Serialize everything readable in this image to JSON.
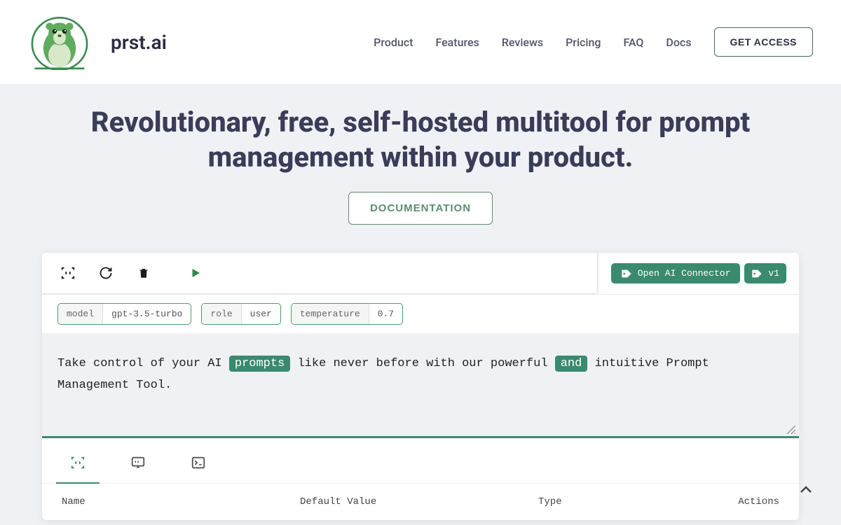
{
  "brand": {
    "name": "prst.ai"
  },
  "nav": {
    "product": "Product",
    "features": "Features",
    "reviews": "Reviews",
    "pricing": "Pricing",
    "faq": "FAQ",
    "docs": "Docs",
    "get_access": "GET ACCESS"
  },
  "hero": {
    "headline": "Revolutionary, free, self-hosted multitool for prompt management within your product.",
    "doc_button": "DOCUMENTATION"
  },
  "toolbar": {
    "connector_label": "Open AI Connector",
    "version_label": "v1"
  },
  "params": [
    {
      "key": "model",
      "value": "gpt-3.5-turbo"
    },
    {
      "key": "role",
      "value": "user"
    },
    {
      "key": "temperature",
      "value": "0.7"
    }
  ],
  "editor": {
    "seg1": "Take control of your AI ",
    "hl1": "prompts",
    "seg2": " like never before with our powerful ",
    "hl2": "and",
    "seg3": " intuitive Prompt Management Tool."
  },
  "table": {
    "headers": {
      "name": "Name",
      "default": "Default Value",
      "type": "Type",
      "actions": "Actions"
    }
  },
  "colors": {
    "accent": "#3a8a6e",
    "heading": "#3a3c58"
  }
}
